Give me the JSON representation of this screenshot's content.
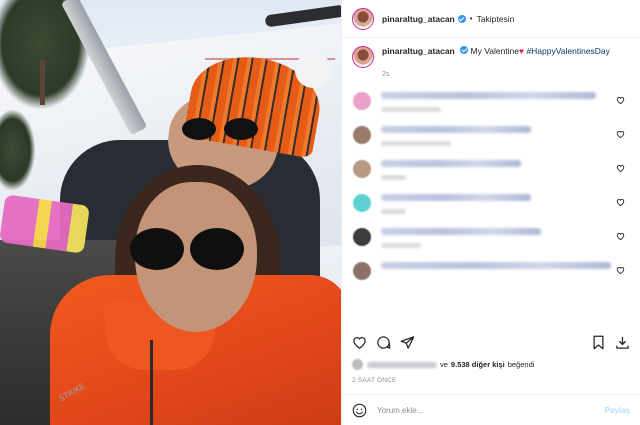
{
  "header": {
    "username": "pinaraltug_atacan",
    "separator": "•",
    "follow_status": "Takiptesin"
  },
  "caption": {
    "username": "pinaraltug_atacan",
    "text": "My Valentine",
    "emoji": "♥",
    "hashtag": "#HappyValentinesDay",
    "time": "2s"
  },
  "comments": [
    {
      "avatar_color": "#e9a0c9",
      "line_width": 215,
      "sub_width": 60
    },
    {
      "avatar_color": "#9a7b6a",
      "line_width": 150,
      "sub_width": 70
    },
    {
      "avatar_color": "#b79a83",
      "line_width": 140,
      "sub_width": 25
    },
    {
      "avatar_color": "#5fd0d4",
      "line_width": 150,
      "sub_width": 25
    },
    {
      "avatar_color": "#3c3c3c",
      "line_width": 160,
      "sub_width": 40
    },
    {
      "avatar_color": "#8c7266",
      "line_width": 230,
      "sub_width": 0
    }
  ],
  "likes": {
    "prefix_name": "",
    "connector": "ve",
    "count_text": "9.538 diğer kişi",
    "suffix": "beğendi"
  },
  "posted_time": "2 SAAT ÖNCE",
  "add_comment": {
    "placeholder": "Yorum ekle...",
    "post_label": "Paylaş"
  },
  "photo": {
    "sleeve_text": "STRIKE"
  },
  "colors": {
    "verified": "#3897f0",
    "hashtag": "#00376b",
    "heart": "#e0245e",
    "post_button": "#b2dffc"
  },
  "icons": [
    "heart-icon",
    "comment-icon",
    "share-icon",
    "bookmark-icon",
    "download-icon",
    "emoji-icon",
    "verified-icon"
  ]
}
